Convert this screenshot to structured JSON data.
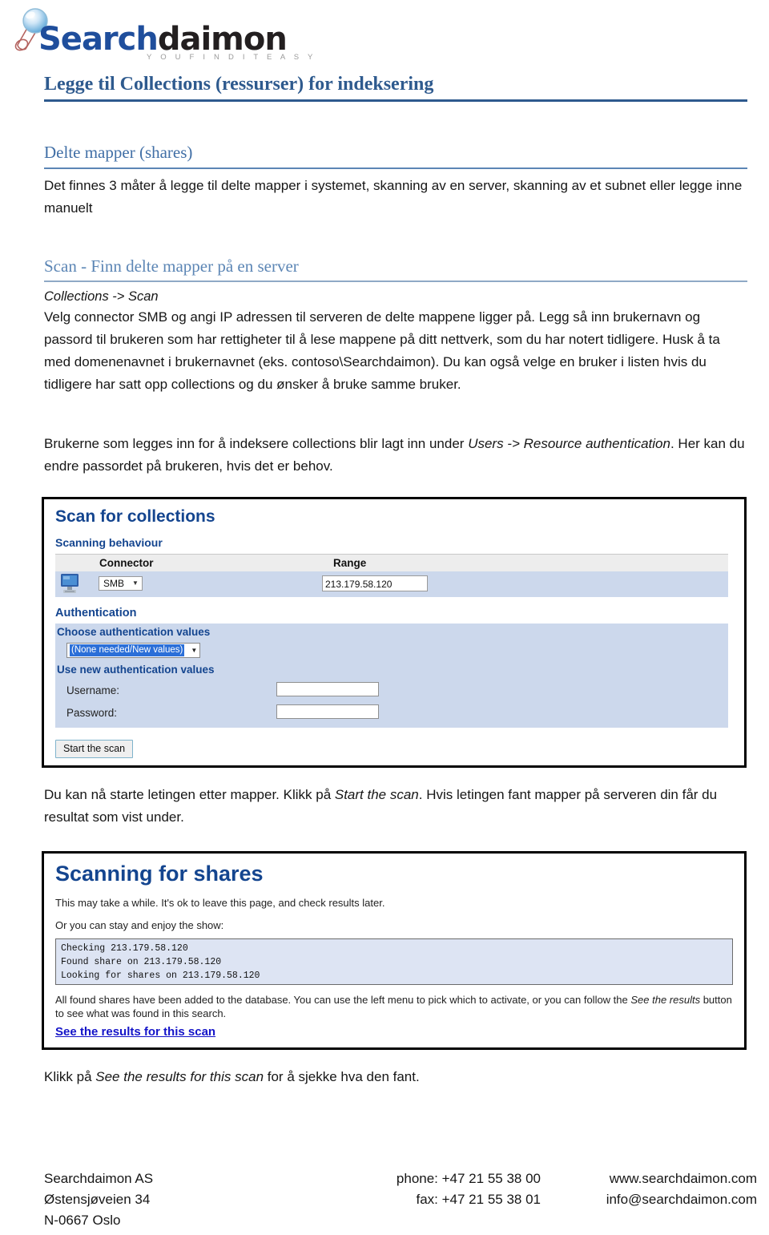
{
  "logo": {
    "word_first": "Search",
    "word_second": "daimon",
    "tagline": "Y O U  F I N D  I T  E A S Y",
    "glass_icon": "magnifying-glass-icon"
  },
  "document": {
    "title": "Legge til Collections (ressurser) for indeksering",
    "sections": [
      {
        "heading": "Delte mapper (shares)",
        "paragraph": "Det finnes 3 måter å legge til delte mapper i systemet, skanning av en server, skanning av et subnet eller legge inne manuelt"
      },
      {
        "heading": "Scan - Finn delte mapper på en server",
        "breadcrumb": "Collections -> Scan",
        "paragraph_main": "Velg connector SMB og angi IP adressen til serveren de delte mappene ligger på. Legg så inn brukernavn og passord til brukeren som har rettigheter til å lese mappene på ditt nettverk, som du har notert tidligere. Husk å ta med domenenavnet i brukernavnet (eks. contoso\\Searchdaimon). Du kan også velge en bruker i listen hvis du tidligere har satt opp collections og du ønsker å bruke samme bruker.",
        "paragraph_users_a": "Brukerne som legges inn for å indeksere collections blir lagt inn under ",
        "paragraph_users_em": "Users -> Resource authentication",
        "paragraph_users_b": ". Her kan du endre passordet på brukeren, hvis det er behov."
      }
    ],
    "caption_after_scan_a": "Du kan nå starte letingen etter mapper. Klikk på ",
    "caption_after_scan_em": "Start the scan",
    "caption_after_scan_b": ". Hvis letingen fant mapper på serveren din får du resultat som vist under.",
    "caption_final_a": "Klikk på ",
    "caption_final_em": "See the results for this scan",
    "caption_final_b": " for å sjekke hva den fant."
  },
  "scan_panel": {
    "title": "Scan for collections",
    "subheading": "Scanning behaviour",
    "table_headers": {
      "connector": "Connector",
      "range": "Range"
    },
    "row": {
      "icon": "computer-monitor-icon",
      "connector_value": "SMB",
      "range_value": "213.179.58.120"
    },
    "auth_heading": "Authentication",
    "choose_label": "Choose authentication values",
    "choose_value": "(None needed/New values)",
    "use_new_label": "Use new authentication values",
    "username_label": "Username:",
    "username_value": "",
    "password_label": "Password:",
    "password_value": "",
    "start_button": "Start the scan"
  },
  "shares_panel": {
    "title": "Scanning for shares",
    "line1": "This may take a while. It's ok to leave this page, and check results later.",
    "line2": "Or you can stay and enjoy the show:",
    "log_lines": [
      "Checking 213.179.58.120",
      "Found share on 213.179.58.120",
      "Looking for shares on 213.179.58.120"
    ],
    "note_a": "All found shares have been added to the database. You can use the left menu to pick which to activate, or you can follow the ",
    "note_em": "See the results",
    "note_b": " button to see what was found in this search.",
    "results_link": "See the results for this scan"
  },
  "footer": {
    "company": "Searchdaimon AS",
    "street": "Østensjøveien 34",
    "city": "N-0667 Oslo",
    "phone": "phone: +47 21 55 38 00",
    "fax": "fax: +47 21 55 38 01",
    "website": "www.searchdaimon.com",
    "email": "info@searchdaimon.com"
  },
  "colors": {
    "heading_navy": "#2E5A8E",
    "heading_blue": "#5C86B5",
    "logo_blue": "#1F4E9C",
    "panel_blue": "#ccd8ec",
    "ui_heading_blue": "#14458F",
    "link_blue": "#1414C8"
  }
}
